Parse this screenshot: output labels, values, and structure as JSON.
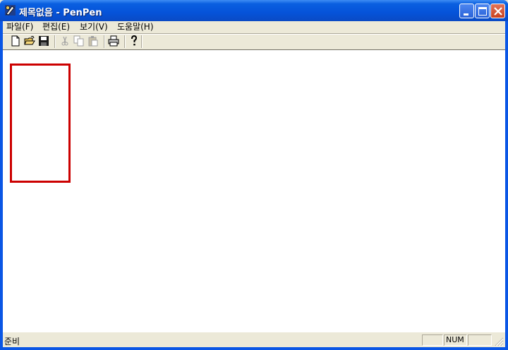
{
  "window": {
    "title": "제목없음 - PenPen",
    "app_icon": "penpen-icon",
    "controls": {
      "minimize": "minimize-icon",
      "maximize": "maximize-icon",
      "close": "close-icon"
    }
  },
  "menu": {
    "items": [
      {
        "label": "파일(F)"
      },
      {
        "label": "편집(E)"
      },
      {
        "label": "보기(V)"
      },
      {
        "label": "도움말(H)"
      }
    ]
  },
  "toolbar": {
    "buttons": [
      {
        "icon": "new-document-icon",
        "enabled": true
      },
      {
        "icon": "open-folder-icon",
        "enabled": true
      },
      {
        "icon": "save-icon",
        "enabled": true
      },
      {
        "icon": "cut-icon",
        "enabled": false
      },
      {
        "icon": "copy-icon",
        "enabled": false
      },
      {
        "icon": "paste-icon",
        "enabled": false
      },
      {
        "icon": "print-icon",
        "enabled": true
      },
      {
        "icon": "help-icon",
        "enabled": true
      }
    ]
  },
  "canvas": {
    "shapes": [
      {
        "type": "rectangle",
        "stroke": "#CC0000"
      }
    ]
  },
  "statusbar": {
    "text": "준비",
    "indicators": {
      "caps": "",
      "num": "NUM",
      "scroll": ""
    }
  }
}
